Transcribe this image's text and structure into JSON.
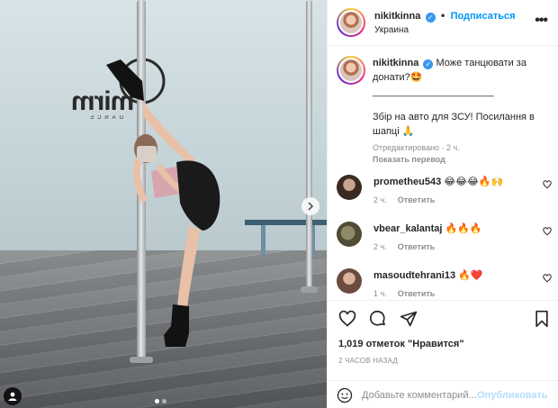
{
  "post": {
    "username": "nikitkinna",
    "follow_label": "Подписаться",
    "separator": "•",
    "location": "Украина",
    "more_label": "•••"
  },
  "caption": {
    "username": "nikitkinna",
    "line1": "Може танцювати за",
    "line2": "донати?🤩",
    "line3": "______________________",
    "line4": "Збір на авто для ЗСУ! Посилання в",
    "line5": "шапці 🙏",
    "edited": "Отредактировано · 2 ч.",
    "translate": "Показать перевод"
  },
  "comments": [
    {
      "user": "prometheu543",
      "text": "😂😂😂🔥🙌",
      "time": "2 ч.",
      "reply": "Ответить"
    },
    {
      "user": "vbear_kalantaj",
      "text": "🔥🔥🔥",
      "time": "2 ч.",
      "reply": "Ответить"
    },
    {
      "user": "masoudtehrani13",
      "text": "🔥❤️",
      "time": "1 ч.",
      "reply": "Ответить"
    }
  ],
  "actions": {
    "likes": "1,019 отметок \"Нравится\"",
    "time_ago": "2 ЧАСОВ НАЗАД"
  },
  "add_comment": {
    "placeholder": "Добавьте комментарий...",
    "publish_label": "Опубликовать"
  },
  "photo": {
    "studio_logo_text": "mirm",
    "studio_logo_sub": "DANCE",
    "carousel_count": 2,
    "carousel_active": 1
  },
  "colors": {
    "accent": "#0095f6",
    "verified": "#3897f0",
    "muted": "#8e8e8e",
    "publish_disabled": "#b2dffc",
    "heart_red": "#ed4956"
  },
  "icons": [
    "verified-badge-icon",
    "more-options-icon",
    "heart-icon",
    "comment-icon",
    "share-icon",
    "bookmark-icon",
    "emoji-icon",
    "tag-person-icon",
    "chevron-right-icon"
  ]
}
